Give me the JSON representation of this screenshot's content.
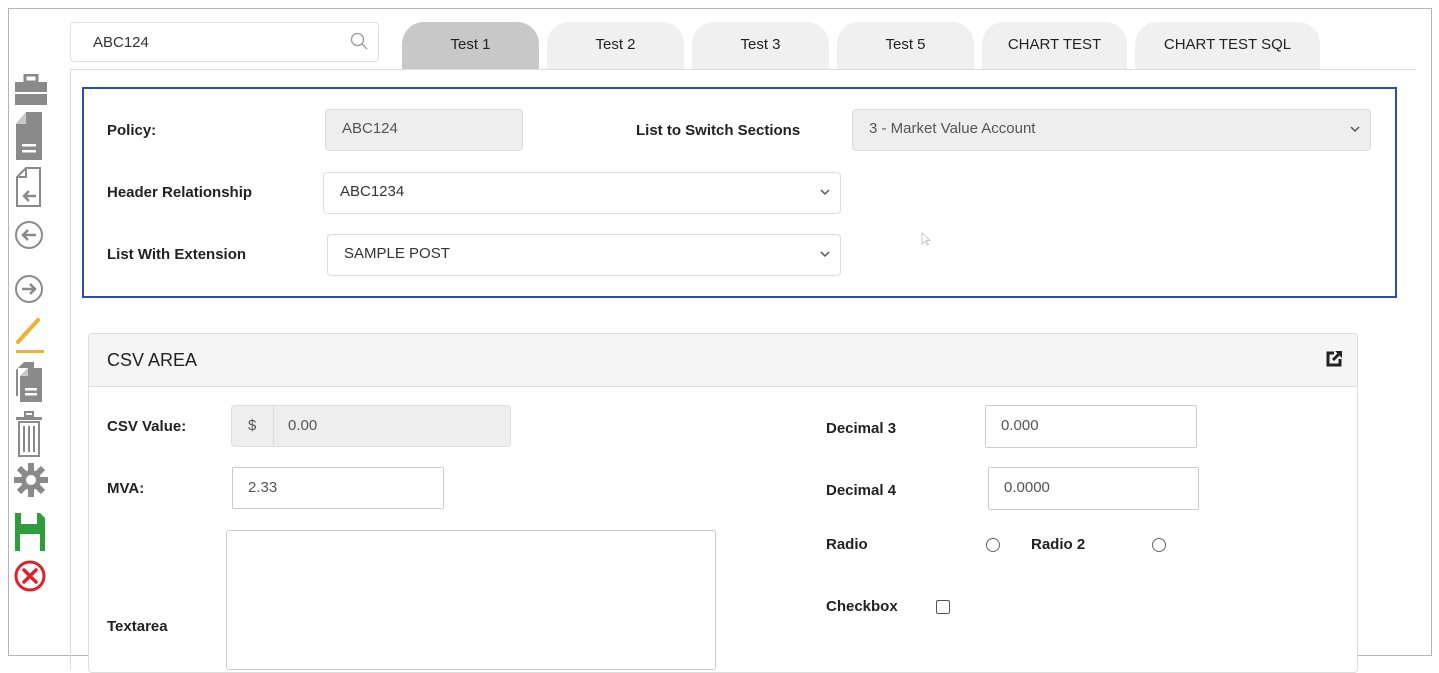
{
  "search": {
    "value": "ABC124"
  },
  "tabs": [
    {
      "label": "Test 1",
      "active": true
    },
    {
      "label": "Test 2",
      "active": false
    },
    {
      "label": "Test 3",
      "active": false
    },
    {
      "label": "Test 5",
      "active": false
    },
    {
      "label": "CHART TEST",
      "active": false
    },
    {
      "label": "CHART TEST SQL",
      "active": false
    }
  ],
  "toolbar": {
    "icons": [
      "briefcase-icon",
      "document-icon",
      "document-import-icon",
      "arrow-left-icon",
      "arrow-right-icon",
      "pencil-icon",
      "copy-icon",
      "trash-icon",
      "gear-icon",
      "save-icon",
      "close-icon"
    ],
    "save_color": "#2e9e3b",
    "close_color": "#e0202a",
    "pencil_color": "#f0b030"
  },
  "header_section": {
    "policy_label": "Policy:",
    "policy_value": "ABC124",
    "switch_label": "List to Switch Sections",
    "switch_value": "3 - Market Value Account",
    "relationship_label": "Header Relationship",
    "relationship_value": "ABC1234",
    "extension_label": "List With Extension",
    "extension_value": "SAMPLE POST",
    "border_color": "#2b4fa8"
  },
  "csv_area": {
    "title": "CSV AREA",
    "csv_value_label": "CSV Value:",
    "csv_currency": "$",
    "csv_value": "0.00",
    "mva_label": "MVA:",
    "mva_value": "2.33",
    "textarea_label": "Textarea",
    "decimal3_label": "Decimal 3",
    "decimal3_value": "0.000",
    "decimal4_label": "Decimal 4",
    "decimal4_value": "0.0000",
    "radio_label": "Radio",
    "radio2_label": "Radio 2",
    "checkbox_label": "Checkbox"
  }
}
